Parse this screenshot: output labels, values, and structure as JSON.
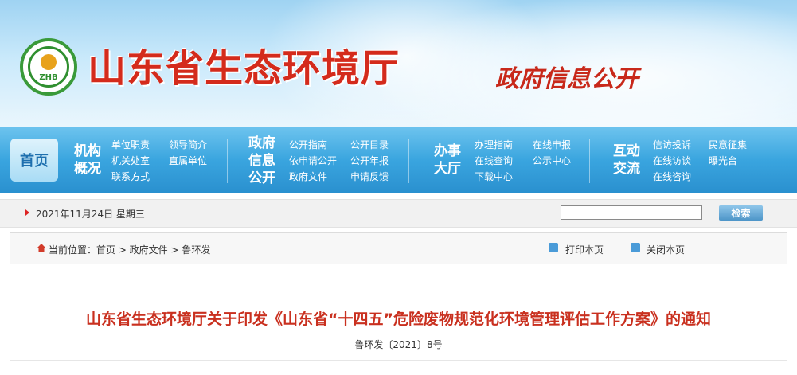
{
  "header": {
    "site_title": "山东省生态环境厅",
    "logo_text": "ZHB",
    "section_title": "政府信息公开"
  },
  "nav": {
    "home_label": "首页",
    "groups": [
      {
        "title_line1": "机构",
        "title_line2": "概况",
        "links": [
          "单位职责",
          "机关处室",
          "联系方式",
          "领导简介",
          "直属单位"
        ]
      },
      {
        "title_line1": "政府",
        "title_line2": "信息",
        "title_line3": "公开",
        "links": [
          "公开指南",
          "依申请公开",
          "政府文件",
          "公开目录",
          "公开年报",
          "申请反馈"
        ]
      },
      {
        "title_line1": "办事",
        "title_line2": "大厅",
        "links": [
          "办理指南",
          "在线查询",
          "下载中心",
          "在线申报",
          "公示中心"
        ]
      },
      {
        "title_line1": "互动",
        "title_line2": "交流",
        "links": [
          "信访投诉",
          "在线访谈",
          "在线咨询",
          "民意征集",
          "曝光台"
        ]
      }
    ]
  },
  "datebar": {
    "date": "2021年11月24日 星期三",
    "search_value": "",
    "search_button": "检索"
  },
  "breadcrumb": {
    "label": "当前位置：首页 > 政府文件 > 鲁环发",
    "print_label": "打印本页",
    "close_label": "关闭本页"
  },
  "document": {
    "title": "山东省生态环境厅关于印发《山东省“十四五”危险废物规范化环境管理评估工作方案》的通知",
    "number": "鲁环发〔2021〕8号"
  },
  "colors": {
    "title_red": "#d42b1c",
    "nav_blue": "#3aa5df"
  }
}
